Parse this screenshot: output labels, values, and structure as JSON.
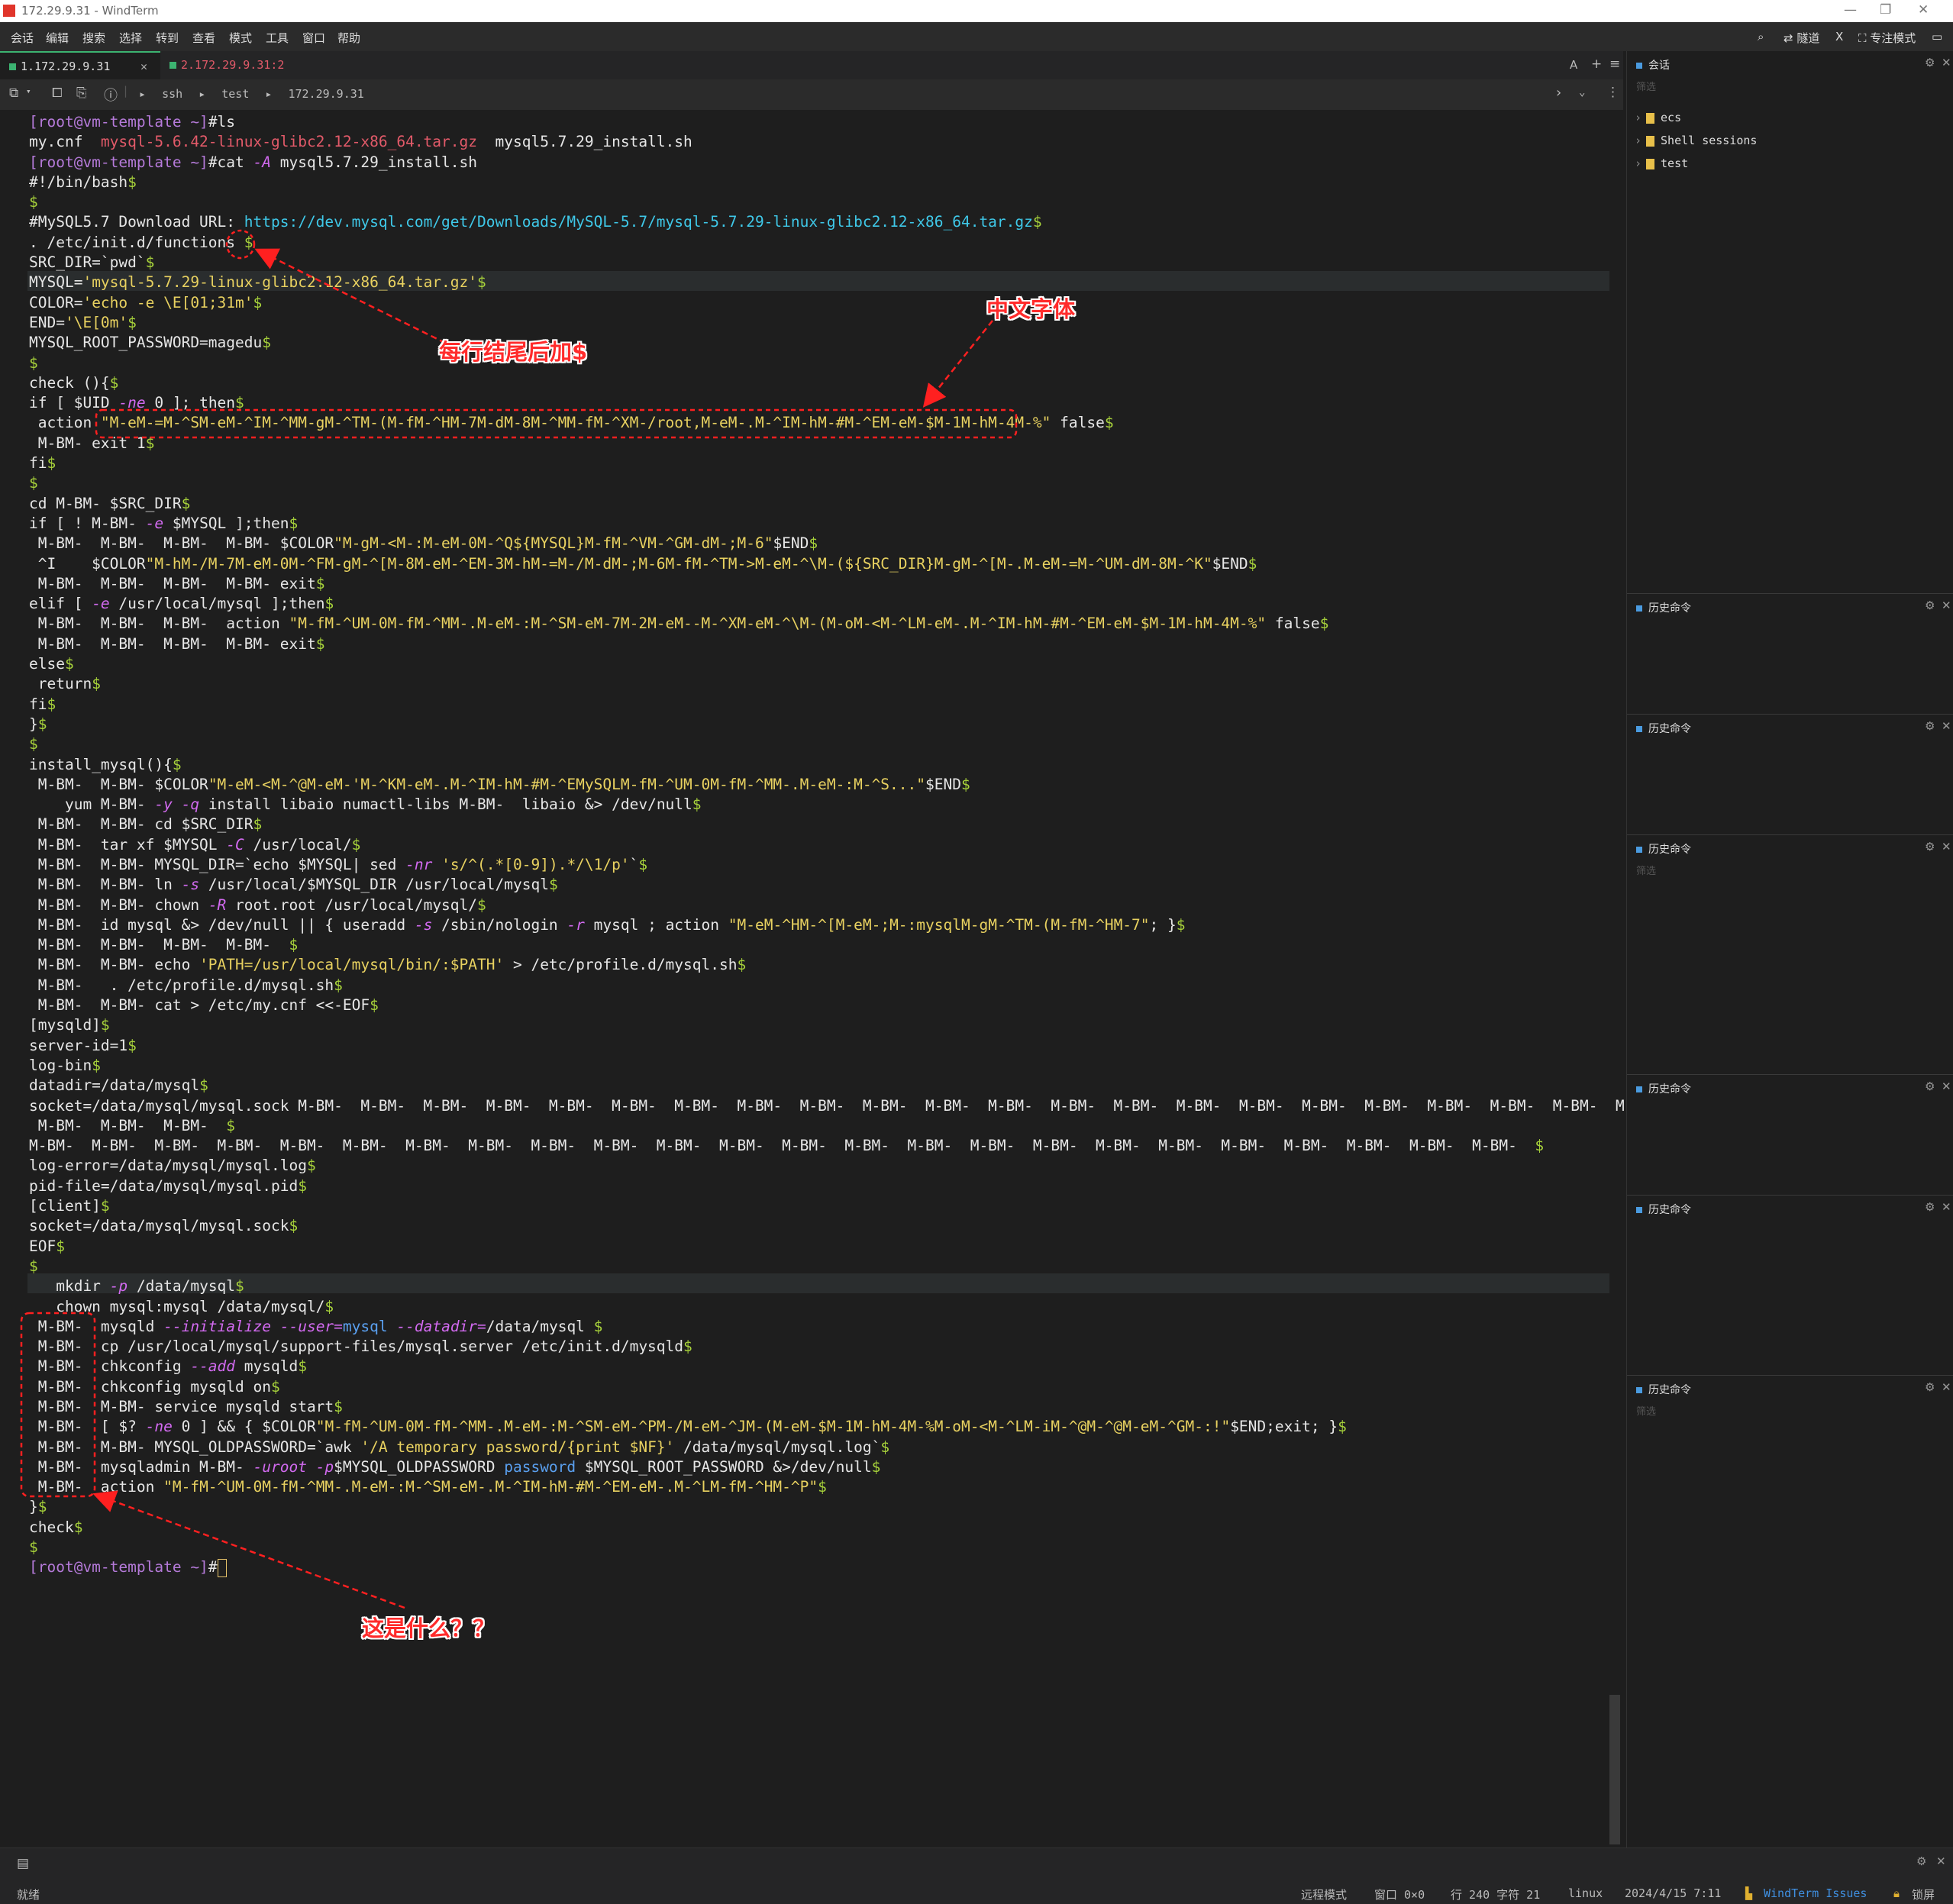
{
  "window": {
    "title": "172.29.9.31 - WindTerm",
    "min": "—",
    "max": "❐",
    "close": "✕"
  },
  "menu": [
    "会话",
    "编辑",
    "搜索",
    "选择",
    "转到",
    "查看",
    "模式",
    "工具",
    "窗口",
    "帮助"
  ],
  "menu_right": {
    "search_icon": "⌕",
    "tunnel": "隧道",
    "x": "X",
    "focus": "专注模式",
    "layout": "▭"
  },
  "tabs": [
    {
      "label": "1.172.29.9.31",
      "close": "✕",
      "color": "#3cb371"
    },
    {
      "label": "2.172.29.9.31:2",
      "color": "#e25a69"
    }
  ],
  "tab_tools": {
    "a": "A",
    "plus": "+",
    "menu": "≡"
  },
  "toolbar": {
    "crumbs": [
      "ssh",
      "test",
      "172.29.9.31"
    ],
    "sep": "▸"
  },
  "terminal_lines": [
    [
      [
        "[root@vm-template ~]",
        "prm"
      ],
      [
        "#ls",
        ""
      ]
    ],
    [
      [
        "my.cnf  ",
        ""
      ],
      [
        "mysql-5.6.42-linux-glibc2.12-x86_64.tar.gz",
        "red"
      ],
      [
        "  mysql5.7.29_install.sh",
        ""
      ]
    ],
    [
      [
        "[root@vm-template ~]",
        "prm"
      ],
      [
        "#cat ",
        ""
      ],
      [
        "-A",
        "opt"
      ],
      [
        " mysql5.7.29_install.sh",
        ""
      ]
    ],
    [
      [
        "#!/bin/bash",
        ""
      ],
      [
        "$",
        "dol"
      ]
    ],
    [
      [
        "$",
        "dol"
      ]
    ],
    [
      [
        "#MySQL5.7 Download URL: ",
        ""
      ],
      [
        "https://dev.mysql.com/get/Downloads/MySQL-5.7/mysql-5.7.29-linux-glibc2.12-x86_64.tar.gz",
        "url"
      ],
      [
        "$",
        "dol"
      ]
    ],
    [
      [
        ". /etc/init.d/functions ",
        ""
      ],
      [
        "$",
        "dol"
      ]
    ],
    [
      [
        "SRC_DIR=`pwd`",
        ""
      ],
      [
        "$",
        "dol"
      ]
    ],
    [
      [
        "MYSQL=",
        ""
      ],
      [
        "'mysql-5.7.29-linux-glibc2.12-x86_64.tar.gz'",
        "str"
      ],
      [
        "$",
        "dol"
      ]
    ],
    [
      [
        "COLOR=",
        ""
      ],
      [
        "'echo -e \\E[01;31m'",
        "str"
      ],
      [
        "$",
        "dol"
      ]
    ],
    [
      [
        "END=",
        ""
      ],
      [
        "'\\E[0m'",
        "str"
      ],
      [
        "$",
        "dol"
      ]
    ],
    [
      [
        "MYSQL_ROOT_PASSWORD=magedu",
        ""
      ],
      [
        "$",
        "dol"
      ]
    ],
    [
      [
        "$",
        "dol"
      ]
    ],
    [
      [
        "check (){",
        ""
      ],
      [
        "$",
        "dol"
      ]
    ],
    [
      [
        "if [ $UID ",
        ""
      ],
      [
        "-ne",
        "opt"
      ],
      [
        " 0 ]; then",
        ""
      ],
      [
        "$",
        "dol"
      ]
    ],
    [
      [
        " action ",
        ""
      ],
      [
        "\"M-eM-=M-^SM-eM-^IM-^MM-gM-^TM-(M-fM-^HM-7M-dM-8M-^MM-fM-^XM-/root,M-eM-.M-^IM-hM-#M-^EM-eM-$M-1M-hM-4M-%\"",
        "str"
      ],
      [
        " false",
        ""
      ],
      [
        "$",
        "dol"
      ]
    ],
    [
      [
        " M-BM- exit 1",
        ""
      ],
      [
        "$",
        "dol"
      ]
    ],
    [
      [
        "fi",
        ""
      ],
      [
        "$",
        "dol"
      ]
    ],
    [
      [
        "$",
        "dol"
      ]
    ],
    [
      [
        "cd M-BM- $SRC_DIR",
        ""
      ],
      [
        "$",
        "dol"
      ]
    ],
    [
      [
        "if [ ! M-BM- ",
        ""
      ],
      [
        "-e",
        "opt"
      ],
      [
        " $MYSQL ];then",
        ""
      ],
      [
        "$",
        "dol"
      ]
    ],
    [
      [
        " M-BM-  M-BM-  M-BM-  M-BM- $COLOR",
        ""
      ],
      [
        "\"M-gM-<M-:M-eM-0M-^Q${MYSQL}M-fM-^VM-^GM-dM-;M-6\"",
        "str"
      ],
      [
        "$END",
        ""
      ],
      [
        "$",
        "dol"
      ]
    ],
    [
      [
        " ^I    $COLOR",
        ""
      ],
      [
        "\"M-hM-/M-7M-eM-0M-^FM-gM-^[M-8M-eM-^EM-3M-hM-=M-/M-dM-;M-6M-fM-^TM->M-eM-^\\M-(${SRC_DIR}M-gM-^[M-.M-eM-=M-^UM-dM-8M-^K\"",
        "str"
      ],
      [
        "$END",
        ""
      ],
      [
        "$",
        "dol"
      ]
    ],
    [
      [
        " M-BM-  M-BM-  M-BM-  M-BM- exit",
        ""
      ],
      [
        "$",
        "dol"
      ]
    ],
    [
      [
        "elif [ ",
        ""
      ],
      [
        "-e",
        "opt"
      ],
      [
        " /usr/local/mysql ];then",
        ""
      ],
      [
        "$",
        "dol"
      ]
    ],
    [
      [
        " M-BM-  M-BM-  M-BM-  action ",
        ""
      ],
      [
        "\"M-fM-^UM-0M-fM-^MM-.M-eM-:M-^SM-eM-7M-2M-eM--M-^XM-eM-^\\M-(M-oM-<M-^LM-eM-.M-^IM-hM-#M-^EM-eM-$M-1M-hM-4M-%\"",
        "str"
      ],
      [
        " false",
        ""
      ],
      [
        "$",
        "dol"
      ]
    ],
    [
      [
        " M-BM-  M-BM-  M-BM-  M-BM- exit",
        ""
      ],
      [
        "$",
        "dol"
      ]
    ],
    [
      [
        "else",
        ""
      ],
      [
        "$",
        "dol"
      ]
    ],
    [
      [
        " return",
        ""
      ],
      [
        "$",
        "dol"
      ]
    ],
    [
      [
        "fi",
        ""
      ],
      [
        "$",
        "dol"
      ]
    ],
    [
      [
        "}",
        ""
      ],
      [
        "$",
        "dol"
      ]
    ],
    [
      [
        "$",
        "dol"
      ]
    ],
    [
      [
        "install_mysql(){",
        ""
      ],
      [
        "$",
        "dol"
      ]
    ],
    [
      [
        " M-BM-  M-BM- $COLOR",
        ""
      ],
      [
        "\"M-eM-<M-^@M-eM-'M-^KM-eM-.M-^IM-hM-#M-^EMySQLM-fM-^UM-0M-fM-^MM-.M-eM-:M-^S...\"",
        "str"
      ],
      [
        "$END",
        ""
      ],
      [
        "$",
        "dol"
      ]
    ],
    [
      [
        "    yum M-BM- ",
        ""
      ],
      [
        "-y -q",
        "opt"
      ],
      [
        " install libaio numactl-libs M-BM-  libaio &> /dev/null",
        ""
      ],
      [
        "$",
        "dol"
      ]
    ],
    [
      [
        " M-BM-  M-BM- cd $SRC_DIR",
        ""
      ],
      [
        "$",
        "dol"
      ]
    ],
    [
      [
        " M-BM-  tar xf $MYSQL ",
        ""
      ],
      [
        "-C",
        "opt"
      ],
      [
        " /usr/local/",
        ""
      ],
      [
        "$",
        "dol"
      ]
    ],
    [
      [
        " M-BM-  M-BM- MYSQL_DIR=`echo $MYSQL| sed ",
        ""
      ],
      [
        "-nr",
        "opt"
      ],
      [
        " ",
        ""
      ],
      [
        "'s/^(.*[0-9]).*/\\1/p'",
        "str"
      ],
      [
        "`",
        ""
      ],
      [
        "$",
        "dol"
      ]
    ],
    [
      [
        " M-BM-  M-BM- ln ",
        ""
      ],
      [
        "-s",
        "opt"
      ],
      [
        " /usr/local/$MYSQL_DIR /usr/local/mysql",
        ""
      ],
      [
        "$",
        "dol"
      ]
    ],
    [
      [
        " M-BM-  M-BM- chown ",
        ""
      ],
      [
        "-R",
        "opt"
      ],
      [
        " root.root /usr/local/mysql/",
        ""
      ],
      [
        "$",
        "dol"
      ]
    ],
    [
      [
        " M-BM-  id mysql &> /dev/null || { useradd ",
        ""
      ],
      [
        "-s",
        "opt"
      ],
      [
        " /sbin/nologin ",
        ""
      ],
      [
        "-r",
        "opt"
      ],
      [
        " mysql ; action ",
        ""
      ],
      [
        "\"M-eM-^HM-^[M-eM-;M-:mysqlM-gM-^TM-(M-fM-^HM-7\"",
        "str"
      ],
      [
        "; }",
        ""
      ],
      [
        "$",
        "dol"
      ]
    ],
    [
      [
        " M-BM-  M-BM-  M-BM-  M-BM-  ",
        ""
      ],
      [
        "$",
        "dol"
      ]
    ],
    [
      [
        " M-BM-  M-BM- echo ",
        ""
      ],
      [
        "'PATH=/usr/local/mysql/bin/:$PATH'",
        "str"
      ],
      [
        " > /etc/profile.d/mysql.sh",
        ""
      ],
      [
        "$",
        "dol"
      ]
    ],
    [
      [
        " M-BM-   . /etc/profile.d/mysql.sh",
        ""
      ],
      [
        "$",
        "dol"
      ]
    ],
    [
      [
        " M-BM-  M-BM- cat > /etc/my.cnf <<-EOF",
        ""
      ],
      [
        "$",
        "dol"
      ]
    ],
    [
      [
        "[mysqld]",
        ""
      ],
      [
        "$",
        "dol"
      ]
    ],
    [
      [
        "server-id=1",
        ""
      ],
      [
        "$",
        "dol"
      ]
    ],
    [
      [
        "log-bin",
        ""
      ],
      [
        "$",
        "dol"
      ]
    ],
    [
      [
        "datadir=/data/mysql",
        ""
      ],
      [
        "$",
        "dol"
      ]
    ],
    [
      [
        "socket=/data/mysql/mysql.sock M-BM-  M-BM-  M-BM-  M-BM-  M-BM-  M-BM-  M-BM-  M-BM-  M-BM-  M-BM-  M-BM-  M-BM-  M-BM-  M-BM-  M-BM-  M-BM-  M-BM-  M-BM-  M-BM-  M-BM-  M-BM-  M-BM- ",
        ""
      ],
      [
        "↲",
        "url"
      ]
    ],
    [
      [
        " M-BM-  M-BM-  M-BM-  ",
        ""
      ],
      [
        "$",
        "dol"
      ]
    ],
    [
      [
        "M-BM-  M-BM-  M-BM-  M-BM-  M-BM-  M-BM-  M-BM-  M-BM-  M-BM-  M-BM-  M-BM-  M-BM-  M-BM-  M-BM-  M-BM-  M-BM-  M-BM-  M-BM-  M-BM-  M-BM-  M-BM-  M-BM-  M-BM-  M-BM-  ",
        ""
      ],
      [
        "$",
        "dol"
      ]
    ],
    [
      [
        "log-error=/data/mysql/mysql.log",
        ""
      ],
      [
        "$",
        "dol"
      ]
    ],
    [
      [
        "pid-file=/data/mysql/mysql.pid",
        ""
      ],
      [
        "$",
        "dol"
      ]
    ],
    [
      [
        "[client]",
        ""
      ],
      [
        "$",
        "dol"
      ]
    ],
    [
      [
        "socket=/data/mysql/mysql.sock",
        ""
      ],
      [
        "$",
        "dol"
      ]
    ],
    [
      [
        "EOF",
        ""
      ],
      [
        "$",
        "dol"
      ]
    ],
    [
      [
        "$",
        "dol"
      ]
    ],
    [
      [
        "   mkdir ",
        ""
      ],
      [
        "-p",
        "opt"
      ],
      [
        " /data/mysql",
        ""
      ],
      [
        "$",
        "dol"
      ]
    ],
    [
      [
        "   chown mysql:mysql /data/mysql/",
        ""
      ],
      [
        "$",
        "dol"
      ]
    ],
    [
      [
        " M-BM-  mysqld ",
        ""
      ],
      [
        "--initialize --user=",
        "opt"
      ],
      [
        "mysql",
        "blu"
      ],
      [
        " ",
        ""
      ],
      [
        "--datadir=",
        "opt"
      ],
      [
        "/data/mysql ",
        ""
      ],
      [
        "$",
        "dol"
      ]
    ],
    [
      [
        " M-BM-  cp /usr/local/mysql/support-files/mysql.server /etc/init.d/mysqld",
        ""
      ],
      [
        "$",
        "dol"
      ]
    ],
    [
      [
        " M-BM-  chkconfig ",
        ""
      ],
      [
        "--add",
        "opt"
      ],
      [
        " mysqld",
        ""
      ],
      [
        "$",
        "dol"
      ]
    ],
    [
      [
        " M-BM-  chkconfig mysqld on",
        ""
      ],
      [
        "$",
        "dol"
      ]
    ],
    [
      [
        " M-BM-  M-BM- service mysqld start",
        ""
      ],
      [
        "$",
        "dol"
      ]
    ],
    [
      [
        " M-BM-  [ $? ",
        ""
      ],
      [
        "-ne",
        "opt"
      ],
      [
        " 0 ] && { $COLOR",
        ""
      ],
      [
        "\"M-fM-^UM-0M-fM-^MM-.M-eM-:M-^SM-eM-^PM-/M-eM-^JM-(M-eM-$M-1M-hM-4M-%M-oM-<M-^LM-iM-^@M-^@M-eM-^GM-:!\"",
        "str"
      ],
      [
        "$END;exit; }",
        ""
      ],
      [
        "$",
        "dol"
      ]
    ],
    [
      [
        " M-BM-  M-BM- MYSQL_OLDPASSWORD=`awk ",
        ""
      ],
      [
        "'/A temporary password/{print $NF}'",
        "str"
      ],
      [
        " /data/mysql/mysql.log`",
        ""
      ],
      [
        "$",
        "dol"
      ]
    ],
    [
      [
        " M-BM-  mysqladmin M-BM- ",
        ""
      ],
      [
        "-uroot -p",
        "opt"
      ],
      [
        "$MYSQL_OLDPASSWORD ",
        ""
      ],
      [
        "password",
        "blu"
      ],
      [
        " $MYSQL_ROOT_PASSWORD &>/dev/null",
        ""
      ],
      [
        "$",
        "dol"
      ]
    ],
    [
      [
        " M-BM-  action ",
        ""
      ],
      [
        "\"M-fM-^UM-0M-fM-^MM-.M-eM-:M-^SM-eM-.M-^IM-hM-#M-^EM-eM-.M-^LM-fM-^HM-^P\"",
        "str"
      ],
      [
        "$",
        "dol"
      ]
    ],
    [
      [
        "}",
        ""
      ],
      [
        "$",
        "dol"
      ]
    ],
    [
      [
        "check",
        ""
      ],
      [
        "$",
        "dol"
      ]
    ],
    [
      [
        "$",
        "dol"
      ]
    ],
    [
      [
        "[root@vm-template ~]",
        "prm"
      ],
      [
        "#",
        ""
      ]
    ]
  ],
  "annotations": {
    "dollar_note": "每行结尾后加$",
    "chinese_note": "中文字体",
    "question_note": "这是什么？？"
  },
  "sidebar": {
    "session_title": "会话",
    "filter_placeholder": "筛选",
    "tree": [
      "ecs",
      "Shell sessions",
      "test"
    ],
    "history_title": "历史命令"
  },
  "status": {
    "ready": "就绪",
    "remote_mode": "远程模式",
    "window": "窗口 0×0",
    "position": "行 240 字符 21",
    "os": "linux",
    "datetime": "2024/4/15 7:11",
    "issues": "WindTerm Issues",
    "lock": "锁屏"
  }
}
